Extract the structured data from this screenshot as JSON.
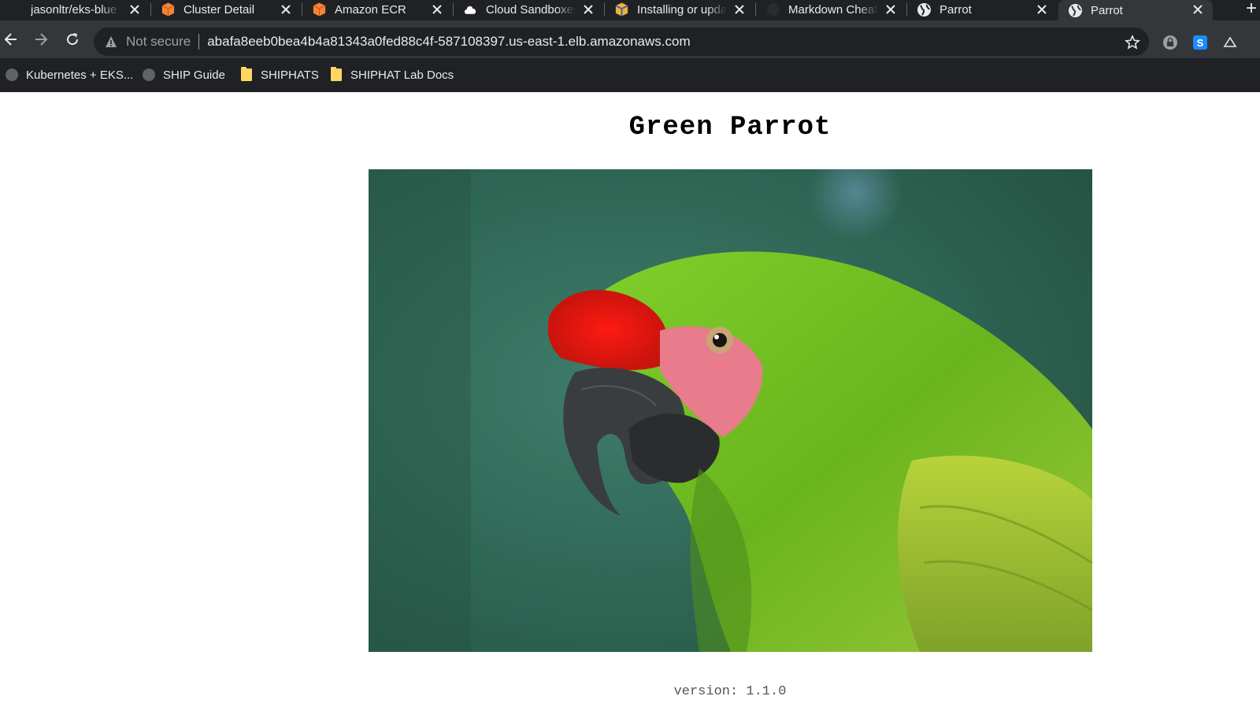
{
  "browser": {
    "tabs": [
      {
        "title": "jasonltr/eks-blue",
        "icon": "github-icon"
      },
      {
        "title": "Cluster Detail",
        "icon": "aws-cube-icon"
      },
      {
        "title": "Amazon ECR",
        "icon": "aws-cube-icon"
      },
      {
        "title": "Cloud Sandboxes",
        "icon": "cloud-icon"
      },
      {
        "title": "Installing or upda",
        "icon": "aws-docs-icon"
      },
      {
        "title": "Markdown Cheat",
        "icon": "github-icon"
      },
      {
        "title": "Parrot",
        "icon": "globe-icon"
      },
      {
        "title": "Parrot",
        "icon": "globe-icon",
        "active": true
      }
    ],
    "new_tab_label": "+",
    "address": {
      "security_label": "Not secure",
      "url": "abafa8eeb0bea4b4a81343a0fed88c4f-587108397.us-east-1.elb.amazonaws.com"
    },
    "bookmarks": [
      {
        "label": "Kubernetes + EKS...",
        "icon": "globe-icon"
      },
      {
        "label": "SHIP Guide",
        "icon": "globe-icon"
      },
      {
        "label": "SHIPHATS",
        "icon": "folder-icon"
      },
      {
        "label": "SHIPHAT Lab Docs",
        "icon": "folder-icon"
      }
    ]
  },
  "page": {
    "heading": "Green Parrot",
    "image_alt": "green parrot photo",
    "version": "version: 1.1.0"
  },
  "colors": {
    "chrome_dark": "#202124",
    "toolbar": "#35363a",
    "chrome_text": "#e8eaed",
    "folder": "#fdd663",
    "aws_orange": "#f58536"
  }
}
